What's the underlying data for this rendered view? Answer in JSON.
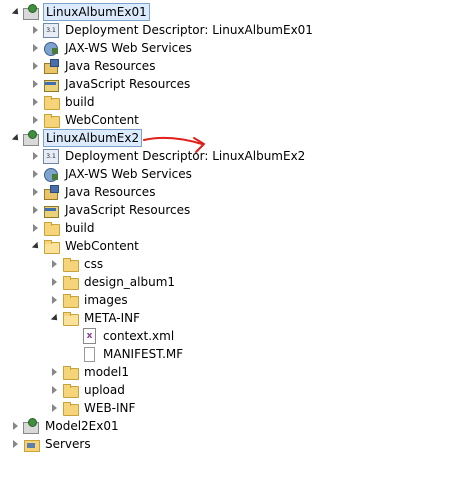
{
  "tree": {
    "items": [
      {
        "label": "LinuxAlbumEx01"
      },
      {
        "label": "Deployment Descriptor: LinuxAlbumEx01"
      },
      {
        "label": "JAX-WS Web Services"
      },
      {
        "label": "Java Resources"
      },
      {
        "label": "JavaScript Resources"
      },
      {
        "label": "build"
      },
      {
        "label": "WebContent"
      },
      {
        "label": "LinuxAlbumEx2"
      },
      {
        "label": "Deployment Descriptor: LinuxAlbumEx2"
      },
      {
        "label": "JAX-WS Web Services"
      },
      {
        "label": "Java Resources"
      },
      {
        "label": "JavaScript Resources"
      },
      {
        "label": "build"
      },
      {
        "label": "WebContent"
      },
      {
        "label": "css"
      },
      {
        "label": "design_album1"
      },
      {
        "label": "images"
      },
      {
        "label": "META-INF"
      },
      {
        "label": "context.xml"
      },
      {
        "label": "MANIFEST.MF"
      },
      {
        "label": "model1"
      },
      {
        "label": "upload"
      },
      {
        "label": "WEB-INF"
      },
      {
        "label": "Model2Ex01"
      },
      {
        "label": "Servers"
      }
    ]
  },
  "colors": {
    "selection_bg": "#dcebfc",
    "selection_border": "#7da2ce",
    "annotation_arrow": "#e0201a"
  }
}
